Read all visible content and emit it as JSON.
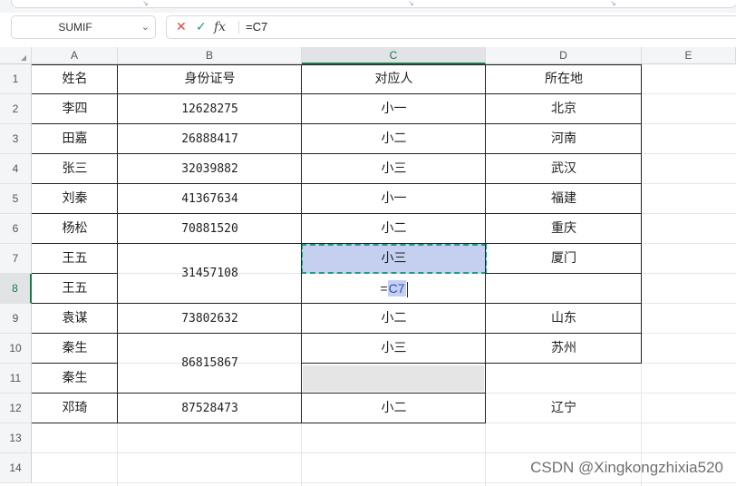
{
  "toolbar_ticks": [
    "↘",
    "↘",
    "↘"
  ],
  "formula_bar": {
    "name_box": "SUMIF",
    "name_box_arrow": "⌄",
    "cancel_icon": "✕",
    "confirm_icon": "✓",
    "fx_label": "fx",
    "formula_text": "=C7"
  },
  "corner_mark": "◢",
  "columns": [
    "A",
    "B",
    "C",
    "D",
    "E"
  ],
  "rows": [
    "1",
    "2",
    "3",
    "4",
    "5",
    "6",
    "7",
    "8",
    "9",
    "10",
    "11",
    "12",
    "13",
    "14"
  ],
  "sheet": {
    "headers": [
      "姓名",
      "身份证号",
      "对应人",
      "所在地"
    ],
    "names": [
      "李四",
      "田嘉",
      "张三",
      "刘秦",
      "杨松",
      "王五",
      "王五",
      "袁谋",
      "秦生",
      "秦生",
      "邓琦"
    ],
    "ids": [
      "12628275",
      "26888417",
      "32039882",
      "41367634",
      "70881520",
      "31457108",
      "73802632",
      "86815867",
      "87528473"
    ],
    "persons": [
      "小一",
      "小二",
      "小三",
      "小一",
      "小二",
      "小三",
      "",
      "小二",
      "小三",
      "",
      "小二"
    ],
    "places": [
      "北京",
      "河南",
      "武汉",
      "福建",
      "重庆",
      "厦门",
      "",
      "山东",
      "苏州",
      "",
      "辽宁"
    ]
  },
  "editing_cell": {
    "equals": "=",
    "reference": "C7"
  },
  "watermark": "CSDN @Xingkongzhixia520",
  "colors": {
    "accent": "#1b7a44",
    "selection_fill": "#c5d0f0",
    "marching_ants": "#1f9d82"
  }
}
